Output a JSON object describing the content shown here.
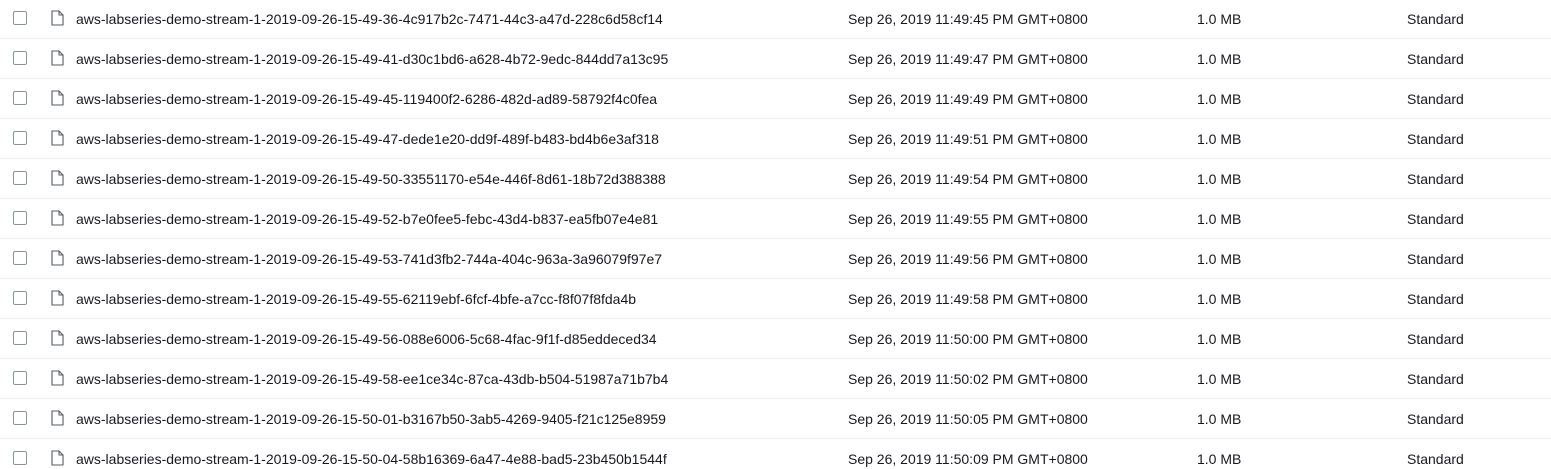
{
  "objects": [
    {
      "name": "aws-labseries-demo-stream-1-2019-09-26-15-49-36-4c917b2c-7471-44c3-a47d-228c6d58cf14",
      "last_modified": "Sep 26, 2019 11:49:45 PM GMT+0800",
      "size": "1.0 MB",
      "storage_class": "Standard",
      "checked": false
    },
    {
      "name": "aws-labseries-demo-stream-1-2019-09-26-15-49-41-d30c1bd6-a628-4b72-9edc-844dd7a13c95",
      "last_modified": "Sep 26, 2019 11:49:47 PM GMT+0800",
      "size": "1.0 MB",
      "storage_class": "Standard",
      "checked": false
    },
    {
      "name": "aws-labseries-demo-stream-1-2019-09-26-15-49-45-119400f2-6286-482d-ad89-58792f4c0fea",
      "last_modified": "Sep 26, 2019 11:49:49 PM GMT+0800",
      "size": "1.0 MB",
      "storage_class": "Standard",
      "checked": false
    },
    {
      "name": "aws-labseries-demo-stream-1-2019-09-26-15-49-47-dede1e20-dd9f-489f-b483-bd4b6e3af318",
      "last_modified": "Sep 26, 2019 11:49:51 PM GMT+0800",
      "size": "1.0 MB",
      "storage_class": "Standard",
      "checked": false
    },
    {
      "name": "aws-labseries-demo-stream-1-2019-09-26-15-49-50-33551170-e54e-446f-8d61-18b72d388388",
      "last_modified": "Sep 26, 2019 11:49:54 PM GMT+0800",
      "size": "1.0 MB",
      "storage_class": "Standard",
      "checked": false
    },
    {
      "name": "aws-labseries-demo-stream-1-2019-09-26-15-49-52-b7e0fee5-febc-43d4-b837-ea5fb07e4e81",
      "last_modified": "Sep 26, 2019 11:49:55 PM GMT+0800",
      "size": "1.0 MB",
      "storage_class": "Standard",
      "checked": false
    },
    {
      "name": "aws-labseries-demo-stream-1-2019-09-26-15-49-53-741d3fb2-744a-404c-963a-3a96079f97e7",
      "last_modified": "Sep 26, 2019 11:49:56 PM GMT+0800",
      "size": "1.0 MB",
      "storage_class": "Standard",
      "checked": false
    },
    {
      "name": "aws-labseries-demo-stream-1-2019-09-26-15-49-55-62119ebf-6fcf-4bfe-a7cc-f8f07f8fda4b",
      "last_modified": "Sep 26, 2019 11:49:58 PM GMT+0800",
      "size": "1.0 MB",
      "storage_class": "Standard",
      "checked": false
    },
    {
      "name": "aws-labseries-demo-stream-1-2019-09-26-15-49-56-088e6006-5c68-4fac-9f1f-d85eddeced34",
      "last_modified": "Sep 26, 2019 11:50:00 PM GMT+0800",
      "size": "1.0 MB",
      "storage_class": "Standard",
      "checked": false
    },
    {
      "name": "aws-labseries-demo-stream-1-2019-09-26-15-49-58-ee1ce34c-87ca-43db-b504-51987a71b7b4",
      "last_modified": "Sep 26, 2019 11:50:02 PM GMT+0800",
      "size": "1.0 MB",
      "storage_class": "Standard",
      "checked": false
    },
    {
      "name": "aws-labseries-demo-stream-1-2019-09-26-15-50-01-b3167b50-3ab5-4269-9405-f21c125e8959",
      "last_modified": "Sep 26, 2019 11:50:05 PM GMT+0800",
      "size": "1.0 MB",
      "storage_class": "Standard",
      "checked": false
    },
    {
      "name": "aws-labseries-demo-stream-1-2019-09-26-15-50-04-58b16369-6a47-4e88-bad5-23b450b1544f",
      "last_modified": "Sep 26, 2019 11:50:09 PM GMT+0800",
      "size": "1.0 MB",
      "storage_class": "Standard",
      "checked": false
    }
  ],
  "icons": {
    "row_icon": "file-icon"
  },
  "colors": {
    "text": "#16191f",
    "row_divider": "#eaeded",
    "checkbox_border": "#879596"
  }
}
